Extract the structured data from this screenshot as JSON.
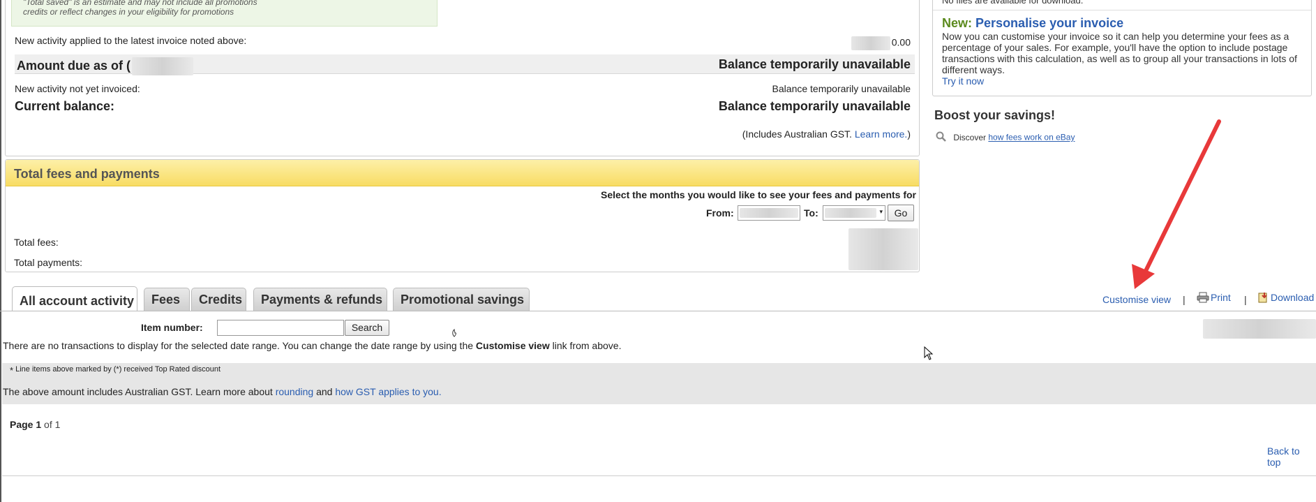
{
  "summary": {
    "note_line1": "\"Total saved\" is an estimate and may not include all promotions",
    "note_line2": "credits or reflect changes in your eligibility for promotions",
    "new_activity_label": "New activity applied to the latest invoice noted above:",
    "new_activity_value": "0.00",
    "amount_due_label": "Amount due as of (",
    "amount_due_value": "Balance temporarily unavailable",
    "not_invoiced_label": "New activity not yet invoiced:",
    "not_invoiced_value": "Balance temporarily unavailable",
    "current_balance_label": "Current balance:",
    "current_balance_value": "Balance temporarily unavailable",
    "gst_note_prefix": "(Includes Australian GST.",
    "gst_learn_more": "Learn more.",
    "gst_note_suffix": ")"
  },
  "fees": {
    "header": "Total fees and payments",
    "select_months": "Select the months you would like to see your fees and payments for",
    "from_label": "From:",
    "to_label": "To:",
    "go_label": "Go",
    "total_fees_label": "Total fees:",
    "total_payments_label": "Total payments:"
  },
  "promo": {
    "top_text": "No files are available for download.",
    "new_label": "New:",
    "title": "Personalise your invoice",
    "body": "Now you can customise your invoice so it can help you determine your fees as a percentage of your sales. For example, you'll have the option to include postage transactions with this calculation, as well as to group all your transactions in lots of different ways.",
    "try_link": "Try it now"
  },
  "boost": {
    "title": "Boost your savings!",
    "discover": "Discover",
    "discover_link": "how fees work on eBay"
  },
  "tabs": [
    {
      "label": "All account activity",
      "active": true
    },
    {
      "label": "Fees"
    },
    {
      "label": "Credits"
    },
    {
      "label": "Payments & refunds"
    },
    {
      "label": "Promotional savings"
    }
  ],
  "toolbar": {
    "customise": "Customise view",
    "print": "Print",
    "download": "Download",
    "sep": "|"
  },
  "content": {
    "item_number_label": "Item number:",
    "search_label": "Search",
    "no_tx_prefix": "There are no transactions to display for the selected date range. You can change the date range by using the",
    "no_tx_link": "Customise view",
    "no_tx_suffix": "link from above.",
    "line_items_note": "Line items above marked by (*) received Top Rated discount",
    "asterisk": "*",
    "gst_text": "The above amount includes Australian GST. Learn more about",
    "rounding_link": "rounding",
    "and_text": "and",
    "gst_link": "how GST applies to you.",
    "page_label": "Page",
    "page_current": "1",
    "page_of": "of 1",
    "back_to_top": "Back to top"
  },
  "colors": {
    "link": "#2a5db0",
    "annotation_arrow": "#e8393a",
    "fees_header": "#f8dc64",
    "promo_new": "#5b8a1d"
  }
}
